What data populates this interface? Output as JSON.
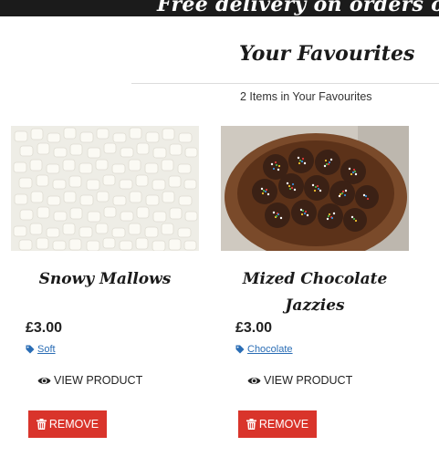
{
  "banner": {
    "text": "Free delivery on orders over £"
  },
  "page": {
    "title": "Your Favourites",
    "count_text": "2 Items in Your Favourites"
  },
  "products": [
    {
      "name": "Snowy Mallows",
      "price": "£3.00",
      "tag": "Soft",
      "view_label": "VIEW PRODUCT",
      "remove_label": "REMOVE",
      "image_icon": "marshmallow-photo"
    },
    {
      "name": "Mized Chocolate Jazzies",
      "price": "£3.00",
      "tag": "Chocolate",
      "view_label": "VIEW PRODUCT",
      "remove_label": "REMOVE",
      "image_icon": "chocolate-jazzies-photo"
    }
  ],
  "colors": {
    "banner_bg": "#1b1b1b",
    "remove_bg": "#d9342b",
    "tag_link": "#2a6db5"
  }
}
